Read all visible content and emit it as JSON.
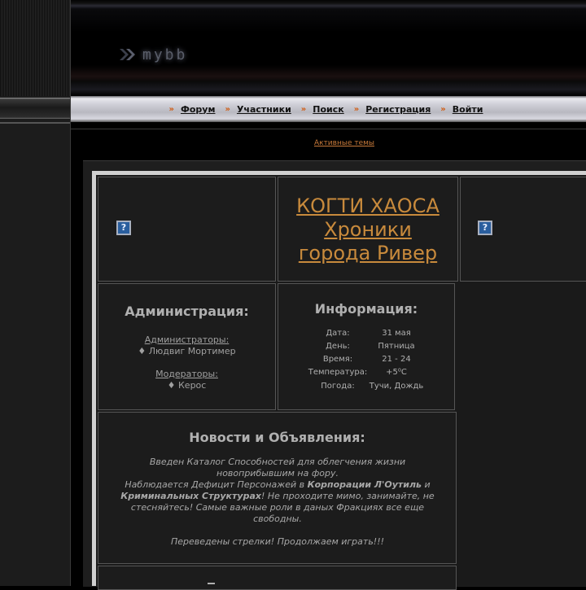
{
  "logo": {
    "text": "mybb"
  },
  "nav": {
    "items": [
      {
        "label": "Форум"
      },
      {
        "label": "Участники"
      },
      {
        "label": "Поиск"
      },
      {
        "label": "Регистрация"
      },
      {
        "label": "Войти"
      }
    ],
    "separator": "»"
  },
  "active_topics": "Активные темы",
  "banner": {
    "title_line1": "КОГТИ ХАОСА",
    "title_line2": "Хроники",
    "title_line3": "города Ривер",
    "icon_glyph": "?"
  },
  "admin": {
    "heading": "Администрация:",
    "admins_label": "Администраторы:",
    "admins_value": "♦ Людвиг Мортимер",
    "mods_label": "Модераторы:",
    "mods_value": "♦ Керос"
  },
  "info": {
    "heading": "Информация:",
    "rows": [
      {
        "key": "Дата:",
        "value": "31 мая"
      },
      {
        "key": "День:",
        "value": "Пятница"
      },
      {
        "key": "Время:",
        "value": "21 - 24"
      },
      {
        "key": "Температура:",
        "value": "+5⁰C"
      },
      {
        "key": "Погода:",
        "value": "Тучи, Дождь"
      }
    ]
  },
  "news": {
    "heading": "Новости и Объявления:",
    "p1": "Введен Каталог Способностей для облегчения жизни новоприбывшим на фору.",
    "p2_start": "Наблюдается Дефицит Персонажей в ",
    "p2_bold1": "Корпорации Л'Оутиль",
    "p2_mid": " и ",
    "p2_bold2": "Криминальных Структурах",
    "p2_end": "! Не проходите мимо, занимайте, не стесняйтесь! Самые важные роли в даных Фракциях все еще свободны.",
    "p3": "Переведены стрелки! Продолжаем играть!!!"
  }
}
